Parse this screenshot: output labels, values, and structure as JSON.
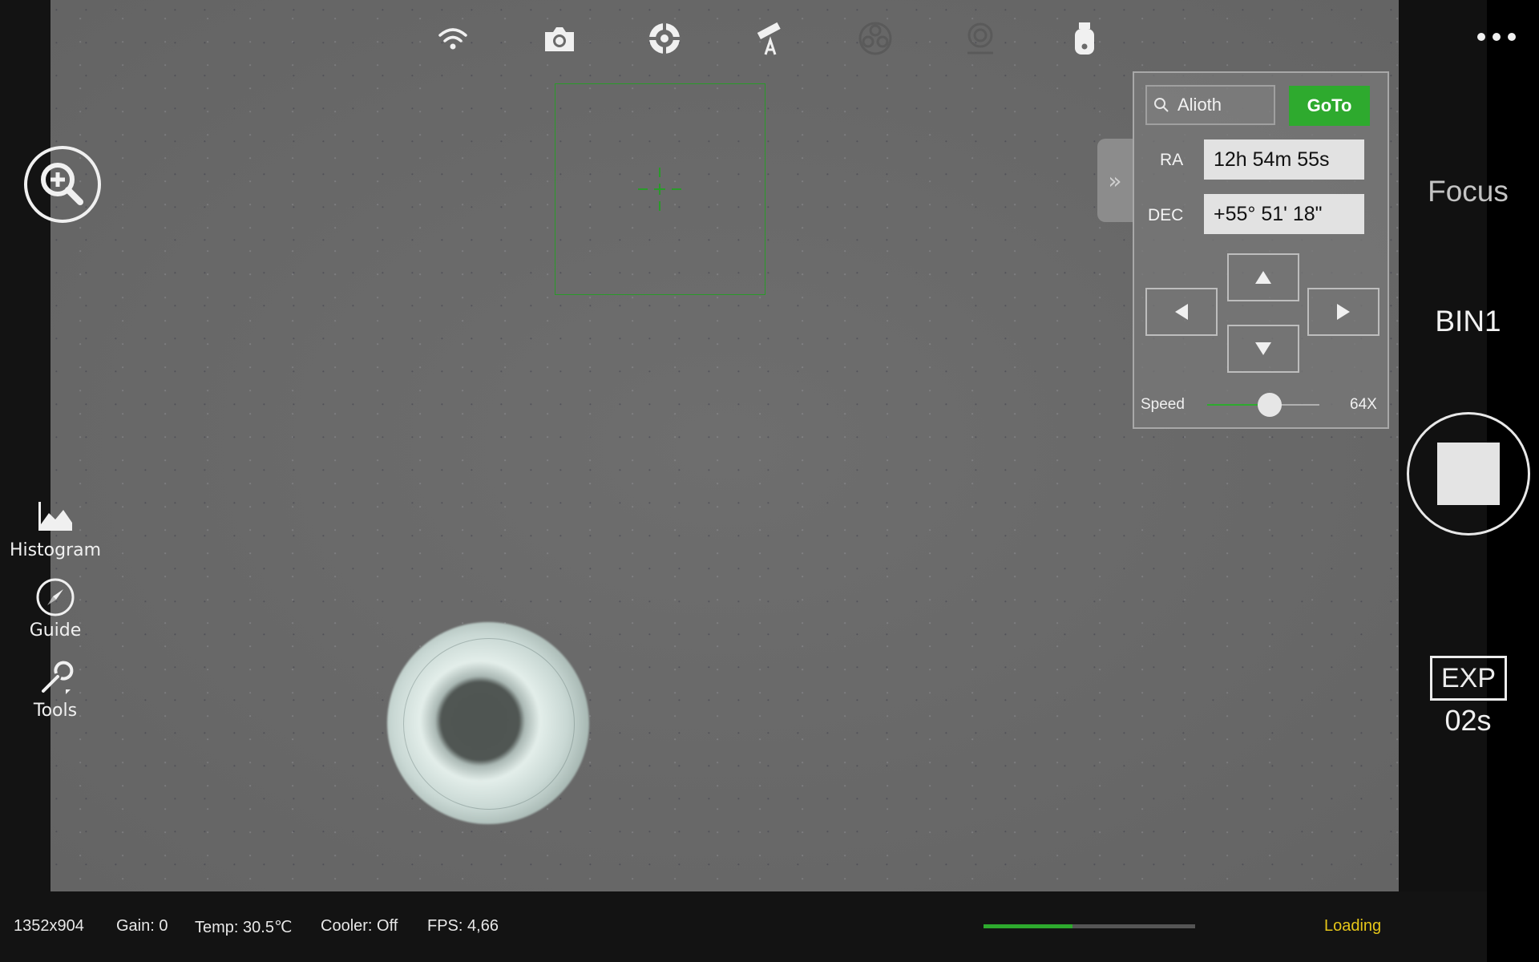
{
  "toolbar": {
    "icons": [
      "wifi-icon",
      "camera-icon",
      "crosshair-target-icon",
      "telescope-mount-icon",
      "filter-wheel-icon",
      "focuser-icon",
      "usb-drive-icon"
    ]
  },
  "left_tools": {
    "histogram_label": "Histogram",
    "guide_label": "Guide",
    "tools_label": "Tools"
  },
  "mount_panel": {
    "search_value": "Alioth",
    "goto_label": "GoTo",
    "ra_label": "RA",
    "ra_value": "12h 54m 55s",
    "dec_label": "DEC",
    "dec_value": "+55° 51' 18\"",
    "speed_label": "Speed",
    "speed_value": "64X",
    "speed_slider_fraction": 0.56
  },
  "right_panel": {
    "mode_label": "Focus",
    "bin_label": "BIN1",
    "exp_label": "EXP",
    "exp_value": "02s"
  },
  "status_bar": {
    "resolution": "1352x904",
    "gain": "Gain: 0",
    "temp": "Temp: 30.5℃",
    "cooler": "Cooler: Off",
    "fps": "FPS: 4,66",
    "progress_fraction": 0.42,
    "loading_label": "Loading"
  },
  "colors": {
    "accent_green": "#2eaa2e",
    "loading_yellow": "#e6c619",
    "background_gray": "#686868"
  }
}
